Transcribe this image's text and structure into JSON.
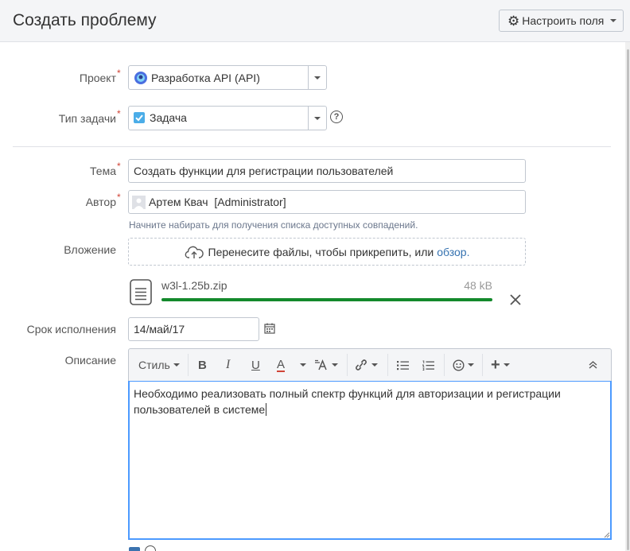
{
  "header": {
    "title": "Создать проблему",
    "configure_fields": "Настроить поля"
  },
  "form": {
    "project": {
      "label": "Проект",
      "value": "Разработка API (API)"
    },
    "issue_type": {
      "label": "Тип задачи",
      "value": "Задача"
    },
    "summary": {
      "label": "Тема",
      "value": "Создать функции для регистрации пользователей"
    },
    "reporter": {
      "label": "Автор",
      "value": "Артем Квач  [Administrator]",
      "hint": "Начните набирать для получения списка доступных совпадений."
    },
    "attachment": {
      "label": "Вложение",
      "drop_text": "Перенесите файлы, чтобы прикрепить, или",
      "browse": "обзор.",
      "file_name": "w3l-1.25b.zip",
      "file_size": "48 kB",
      "progress": 1.0
    },
    "due_date": {
      "label": "Срок исполнения",
      "value": "14/май/17"
    },
    "description": {
      "label": "Описание",
      "style_label": "Стиль",
      "text": "Необходимо реализовать полный спектр функций для авторизации и регистрации пользователей в системе"
    }
  },
  "colors": {
    "required": "#d04437",
    "progress": "#14892c",
    "link": "#3572b0",
    "focus": "#4c9aff"
  },
  "required_mark": "*",
  "help_mark": "?"
}
